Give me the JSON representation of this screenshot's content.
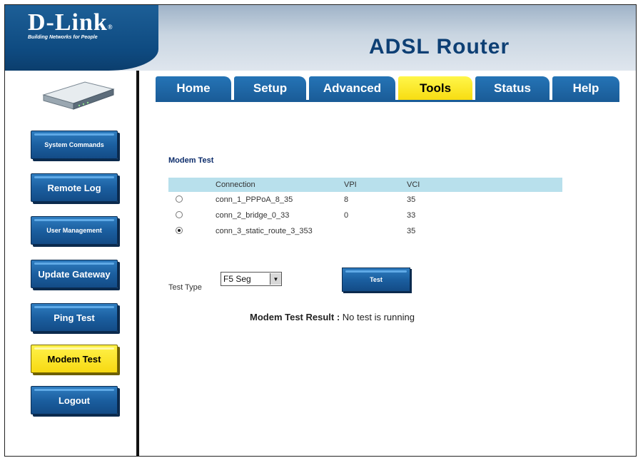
{
  "header": {
    "logo_text": "D-Link",
    "logo_mark": "®",
    "logo_tagline": "Building Networks for People",
    "product_title": "ADSL Router",
    "device_icon": "router-device-image"
  },
  "tabs": [
    {
      "label": "Home",
      "active": false
    },
    {
      "label": "Setup",
      "active": false
    },
    {
      "label": "Advanced",
      "active": false
    },
    {
      "label": "Tools",
      "active": true
    },
    {
      "label": "Status",
      "active": false
    },
    {
      "label": "Help",
      "active": false
    }
  ],
  "sidebar": {
    "items": [
      {
        "label": "System Commands",
        "active": false
      },
      {
        "label": "Remote Log",
        "active": false
      },
      {
        "label": "User Management",
        "active": false
      },
      {
        "label": "Update Gateway",
        "active": false
      },
      {
        "label": "Ping Test",
        "active": false
      },
      {
        "label": "Modem Test",
        "active": true
      },
      {
        "label": "Logout",
        "active": false
      }
    ]
  },
  "main": {
    "section_title": "Modem Test",
    "table": {
      "headers": [
        "Connection",
        "VPI",
        "VCI"
      ],
      "rows": [
        {
          "connection": "conn_1_PPPoA_8_35",
          "vpi": "8",
          "vci": "35",
          "selected": false
        },
        {
          "connection": "conn_2_bridge_0_33",
          "vpi": "0",
          "vci": "33",
          "selected": false
        },
        {
          "connection": "conn_3_static_route_3_353",
          "vpi": "",
          "vci": "35",
          "selected": true
        }
      ]
    },
    "test_type_label": "Test Type",
    "test_type_value": "F5 Seg",
    "test_button_label": "Test",
    "result_label": "Modem Test Result :",
    "result_value": "No test is running"
  },
  "colors": {
    "brand_blue": "#1a5c98",
    "active_yellow": "#f7dc10",
    "table_header": "#b8e0ec"
  }
}
